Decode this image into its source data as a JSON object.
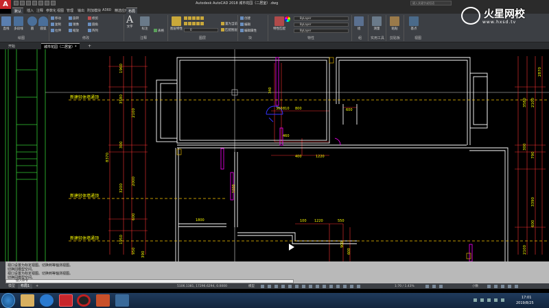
{
  "app": {
    "logo": "A",
    "title": "Autodesk AutoCAD 2018    城市花园（二居室）.dwg",
    "search_placeholder": "键入关键字或短语"
  },
  "ribbon_tabs": [
    "默认",
    "插入",
    "注释",
    "参数化",
    "视图",
    "管理",
    "输出",
    "附加模块",
    "A360",
    "精选应用",
    "布局"
  ],
  "ribbon": {
    "draw_tools": [
      "直线",
      "多段线",
      "圆",
      "圆弧"
    ],
    "modify_tools": [
      "移动",
      "旋转",
      "修剪",
      "复制",
      "镜像",
      "圆角",
      "拉伸",
      "缩放",
      "阵列"
    ],
    "annotation": {
      "text": "文字",
      "dimension": "标注"
    },
    "table_label": "表格",
    "layers": {
      "layer_properties": "图层特性",
      "current_layer": "0",
      "make_current": "置为当前",
      "match": "匹配图层"
    },
    "block": {
      "insert": "插入",
      "create": "创建",
      "edit": "编辑",
      "edit_attr": "编辑属性"
    },
    "properties": {
      "match": "特性匹配",
      "color": "ByLayer",
      "linetype": "ByLayer",
      "lineweight": "ByLayer"
    },
    "groups": {
      "group": "组"
    },
    "utilities": {
      "measure": "测量"
    },
    "clipboard": {
      "paste": "粘贴"
    },
    "view": {
      "base": "基点"
    },
    "panel_titles": [
      "绘图",
      "修改",
      "注释",
      "图层",
      "块",
      "特性",
      "组",
      "实用工具",
      "剪贴板",
      "视图"
    ]
  },
  "doc_tabs": [
    {
      "label": "开始",
      "active": false
    },
    {
      "label": "城市花园（二居室）*",
      "active": true
    }
  ],
  "drawing": {
    "annotations": [
      "新建轻体墙通顶",
      "新建轻体墙通顶",
      "新建轻体墙通顶"
    ],
    "dims_left": [
      "1960",
      "3580",
      "2100",
      "300",
      "8370",
      "3200",
      "2000",
      "600",
      "1950",
      "950",
      "390"
    ],
    "dims_right": [
      "2870",
      "3580",
      "2100",
      "300",
      "790",
      "3390",
      "600",
      "2100"
    ],
    "dims_inner": [
      "340",
      "810",
      "800",
      "600",
      "460",
      "400",
      "1220",
      "1000",
      "1800",
      "100",
      "1220",
      "550",
      "900",
      "600",
      "360"
    ]
  },
  "command": {
    "history": [
      "视口设置为标定视图。切换到等轴测视图。",
      "切换回模型空间。",
      "视口设置为标定视图。切换到等轴测视图。",
      "切换回模型空间。"
    ],
    "prompt": "键入命令"
  },
  "layout_tabs": [
    {
      "label": "模型",
      "active": false
    },
    {
      "label": "布局1",
      "active": true
    }
  ],
  "status": {
    "coords": "5106.1381, 17296.6294, 0.0000",
    "model_label": "模型",
    "scale": "1:70 / 1.43%",
    "decimal_label": "小数"
  },
  "taskbar": {
    "time": "17:01",
    "date": "2019/8/25"
  },
  "watermark": {
    "title": "火星网校",
    "url": "www.hxsd.tv"
  },
  "colors": {
    "wall": "#ffffff",
    "dimension": "#ff3333",
    "dim_text": "#ffff00",
    "frame": "#33cc33",
    "door": "#ff00ff",
    "blue": "#3333ff",
    "grid": "#bbbbbb"
  }
}
